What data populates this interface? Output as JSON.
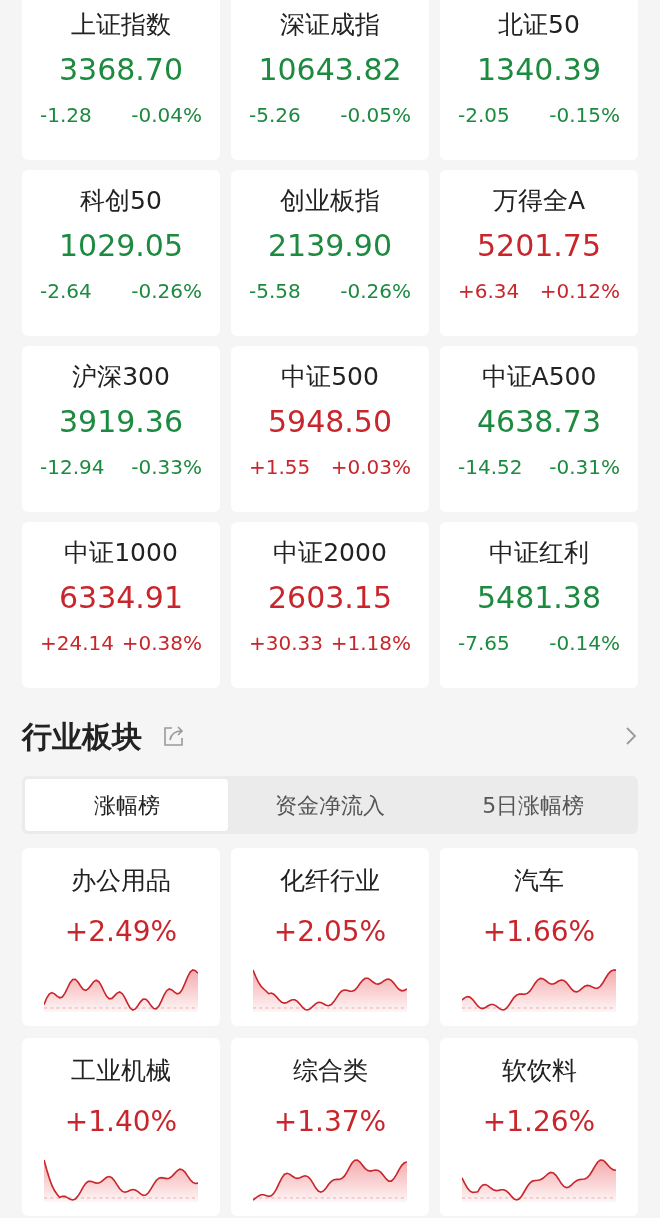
{
  "indices": [
    {
      "name": "上证指数",
      "value": "3368.70",
      "change": "-1.28",
      "percent": "-0.04%",
      "color": "#1c8a3f"
    },
    {
      "name": "深证成指",
      "value": "10643.82",
      "change": "-5.26",
      "percent": "-0.05%",
      "color": "#1c8a3f"
    },
    {
      "name": "北证50",
      "value": "1340.39",
      "change": "-2.05",
      "percent": "-0.15%",
      "color": "#1c8a3f"
    },
    {
      "name": "科创50",
      "value": "1029.05",
      "change": "-2.64",
      "percent": "-0.26%",
      "color": "#1c8a3f"
    },
    {
      "name": "创业板指",
      "value": "2139.90",
      "change": "-5.58",
      "percent": "-0.26%",
      "color": "#1c8a3f"
    },
    {
      "name": "万得全A",
      "value": "5201.75",
      "change": "+6.34",
      "percent": "+0.12%",
      "color": "#c8262c"
    },
    {
      "name": "沪深300",
      "value": "3919.36",
      "change": "-12.94",
      "percent": "-0.33%",
      "color": "#1c8a3f"
    },
    {
      "name": "中证500",
      "value": "5948.50",
      "change": "+1.55",
      "percent": "+0.03%",
      "color": "#c8262c"
    },
    {
      "name": "中证A500",
      "value": "4638.73",
      "change": "-14.52",
      "percent": "-0.31%",
      "color": "#1c8a3f"
    },
    {
      "name": "中证1000",
      "value": "6334.91",
      "change": "+24.14",
      "percent": "+0.38%",
      "color": "#c8262c"
    },
    {
      "name": "中证2000",
      "value": "2603.15",
      "change": "+30.33",
      "percent": "+1.18%",
      "color": "#c8262c"
    },
    {
      "name": "中证红利",
      "value": "5481.38",
      "change": "-7.65",
      "percent": "-0.14%",
      "color": "#1c8a3f"
    }
  ],
  "sector_section": {
    "title": "行业板块",
    "tabs": [
      {
        "label": "涨幅榜",
        "selected": true
      },
      {
        "label": "资金净流入",
        "selected": false
      },
      {
        "label": "5日涨幅榜",
        "selected": false
      }
    ],
    "sectors": [
      {
        "name": "办公用品",
        "percent": "+2.49%",
        "color": "#c8262c"
      },
      {
        "name": "化纤行业",
        "percent": "+2.05%",
        "color": "#c8262c"
      },
      {
        "name": "汽车",
        "percent": "+1.66%",
        "color": "#c8262c"
      },
      {
        "name": "工业机械",
        "percent": "+1.40%",
        "color": "#c8262c"
      },
      {
        "name": "综合类",
        "percent": "+1.37%",
        "color": "#c8262c"
      },
      {
        "name": "软饮料",
        "percent": "+1.26%",
        "color": "#c8262c"
      }
    ]
  }
}
